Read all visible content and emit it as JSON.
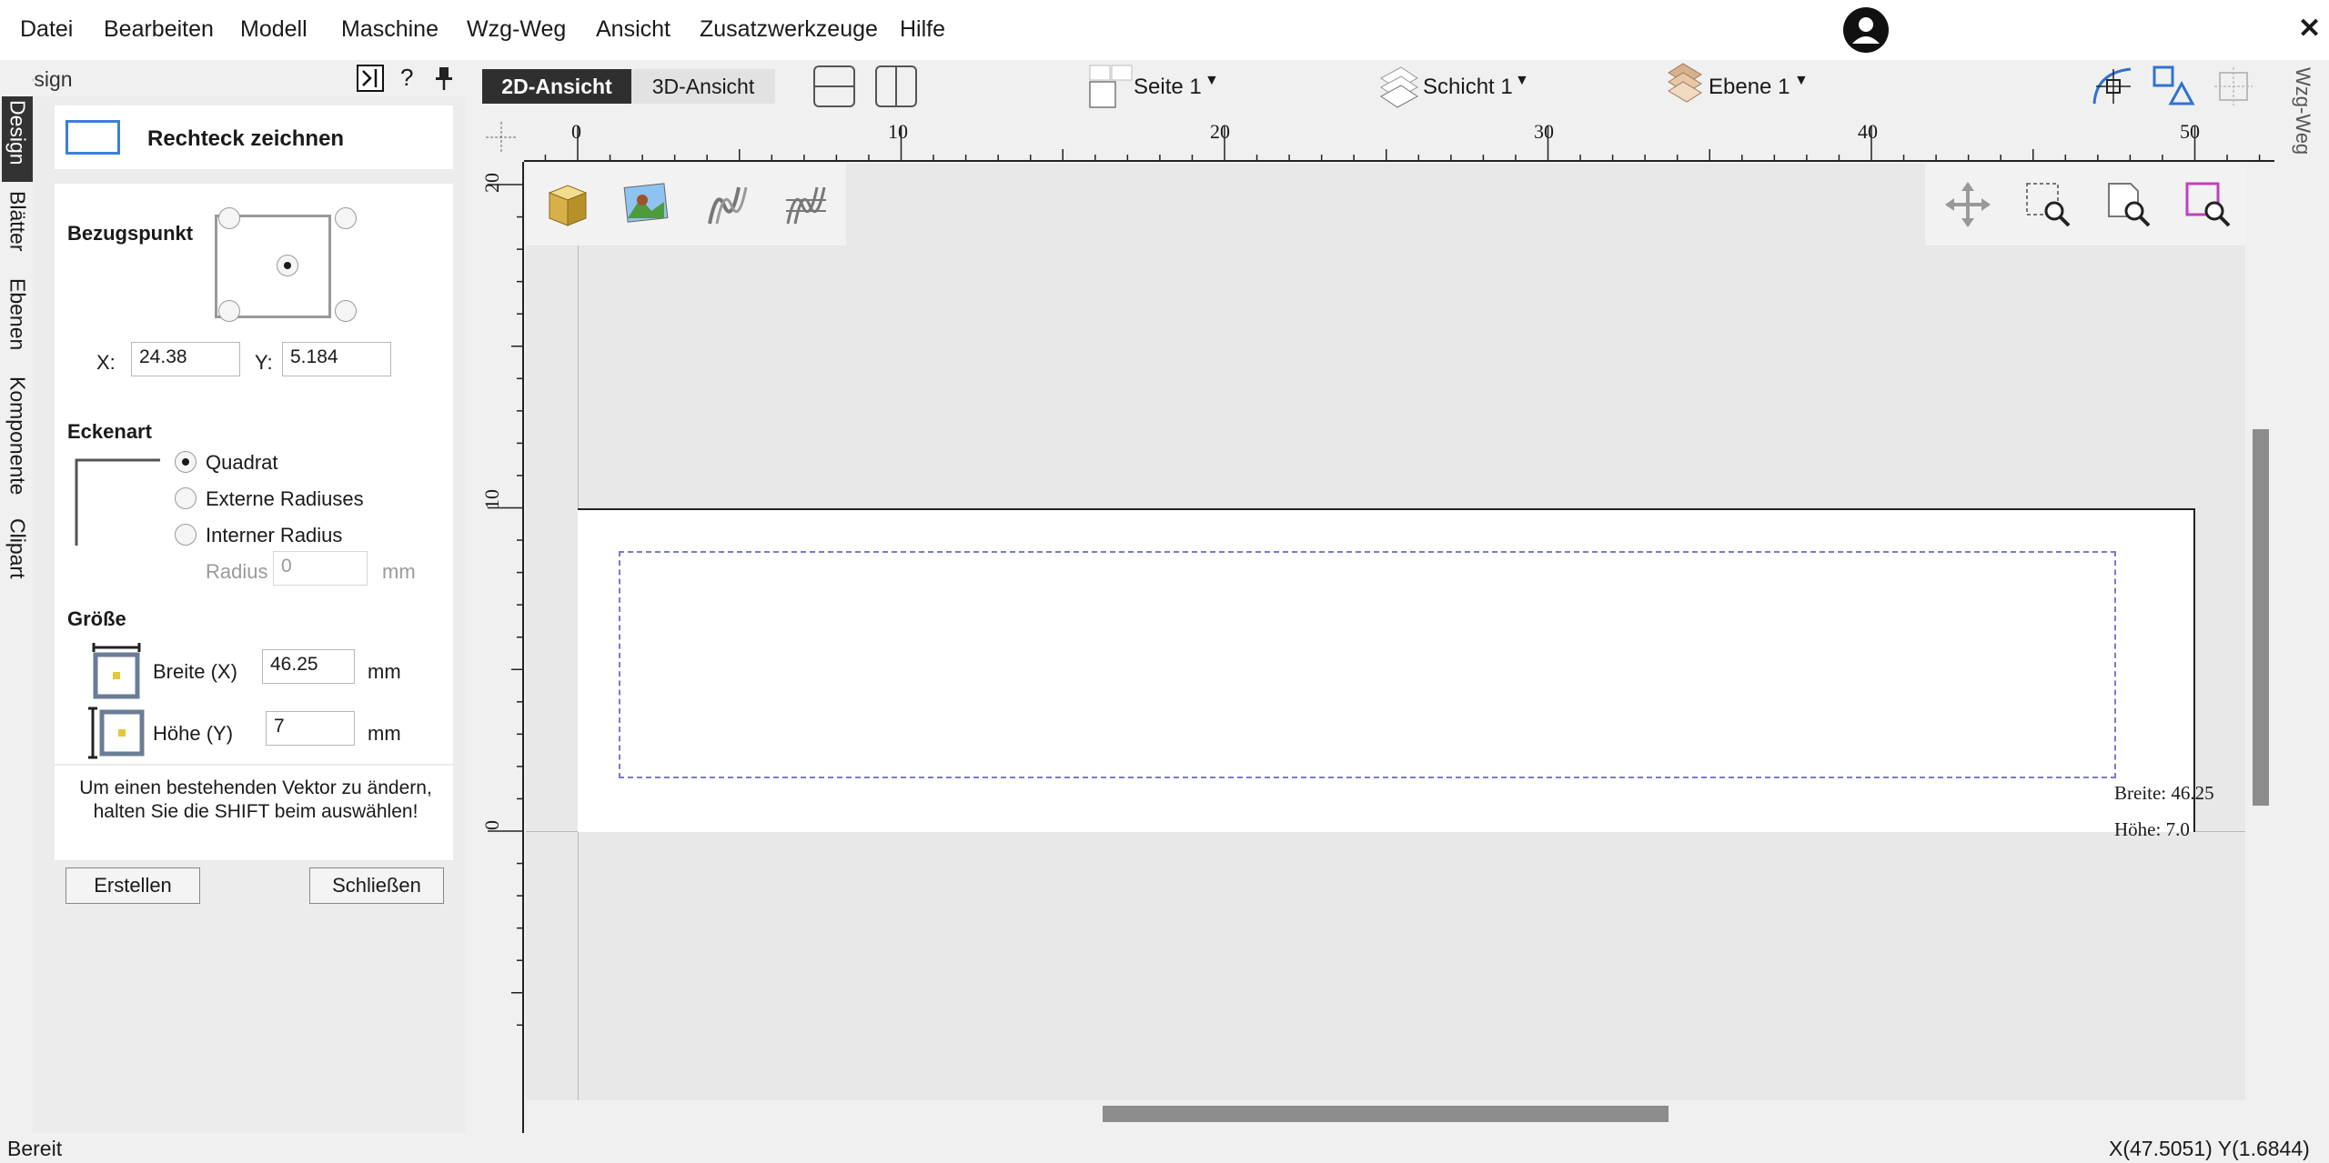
{
  "menu": [
    "Datei",
    "Bearbeiten",
    "Modell",
    "Maschine",
    "Wzg-Weg",
    "Ansicht",
    "Zusatzwerkzeuge",
    "Hilfe"
  ],
  "window": {
    "close_glyph": "✕"
  },
  "left_tabs": [
    "Design",
    "Blätter",
    "Ebenen",
    "Komponente",
    "Clipart"
  ],
  "panel": {
    "title": "Design",
    "help": "?",
    "tool_title": "Rechteck zeichnen",
    "reference_heading": "Bezugspunkt",
    "x_label": "X:",
    "x_value": "24.38",
    "y_label": "Y:",
    "y_value": "5.184",
    "corner_heading": "Eckenart",
    "corner_options": [
      "Quadrat",
      "Externe Radiuses",
      "Interner Radius"
    ],
    "corner_selected": "Quadrat",
    "radius_label": "Radius",
    "radius_value": "0",
    "radius_unit": "mm",
    "size_heading": "Größe",
    "width_label": "Breite (X)",
    "width_value": "46.25",
    "width_unit": "mm",
    "height_label": "Höhe (Y)",
    "height_value": "7",
    "height_unit": "mm",
    "hint": "Um einen bestehenden Vektor zu ändern, halten Sie die SHIFT beim auswählen!",
    "create_button": "Erstellen",
    "close_button": "Schließen"
  },
  "toolbar": {
    "view_2d": "2D-Ansicht",
    "view_3d": "3D-Ansicht",
    "page": "Seite 1",
    "layer": "Schicht 1",
    "level": "Ebene 1"
  },
  "ruler_top": [
    "0",
    "10",
    "20",
    "30",
    "40",
    "50"
  ],
  "ruler_left": [
    "20",
    "10",
    "0"
  ],
  "canvas": {
    "width_readout": "Breite: 46.25",
    "height_readout": "Höhe: 7.0"
  },
  "right_tab": "Wzg-Weg",
  "status": {
    "text": "Bereit",
    "coords": "X(47.5051) Y(1.6844)"
  },
  "colors": {
    "accent_dark": "#333333",
    "rect_blue": "#3e7fd8",
    "selection_dashed": "#7a7ad0",
    "magenta": "#c040c0"
  }
}
